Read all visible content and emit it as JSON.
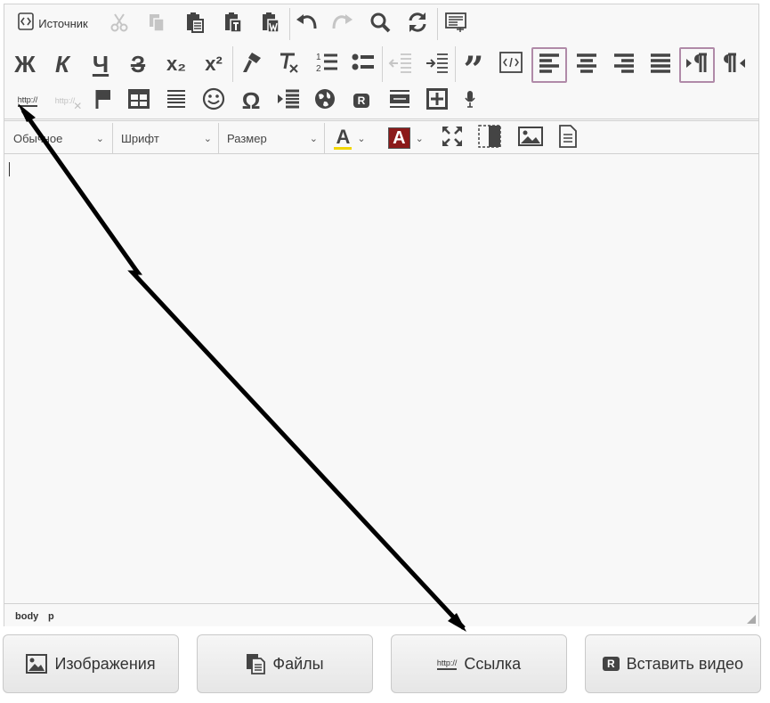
{
  "toolbar": {
    "source_label": "Источник",
    "bold_glyph": "Ж",
    "italic_glyph": "К",
    "underline_glyph": "Ч",
    "strike_glyph": "З",
    "subscript_glyph": "x₂",
    "superscript_glyph": "x²",
    "link_glyph": "http://",
    "unlink_glyph": "http://",
    "omega_glyph": "Ω",
    "icons": [
      "source-icon",
      "cut-icon",
      "copy-icon",
      "paste-icon",
      "paste-text-icon",
      "paste-word-icon",
      "undo-icon",
      "redo-icon",
      "find-icon",
      "replace-icon",
      "templates-icon",
      "bold-icon",
      "italic-icon",
      "underline-icon",
      "strike-icon",
      "subscript-icon",
      "superscript-icon",
      "copy-format-icon",
      "remove-format-icon",
      "numbered-list-icon",
      "bulleted-list-icon",
      "outdent-icon",
      "indent-icon",
      "blockquote-icon",
      "code-snippet-icon",
      "align-left-icon",
      "align-center-icon",
      "align-right-icon",
      "justify-icon",
      "ltr-icon",
      "rtl-icon",
      "link-icon",
      "unlink-icon",
      "anchor-icon",
      "table-icon",
      "horizontal-rule-icon",
      "smiley-icon",
      "special-char-icon",
      "page-break-icon",
      "iframe-icon",
      "video-icon",
      "image-gallery-icon",
      "add-block-icon",
      "mic-icon"
    ]
  },
  "combos": {
    "format_label": "Обычное",
    "font_label": "Шрифт",
    "size_label": "Размер",
    "text_color_glyph": "A",
    "bg_color_glyph": "A"
  },
  "colors": {
    "active_border": "#b08aa8",
    "text_color_underline": "#f2d600",
    "bg_color_box": "#8b1a1a"
  },
  "statusbar": {
    "path": [
      "body",
      "p"
    ]
  },
  "buttons": {
    "images": "Изображения",
    "files": "Файлы",
    "link": "Ссылка",
    "link_prefix": "http://",
    "video": "Вставить видео",
    "video_badge": "R"
  }
}
